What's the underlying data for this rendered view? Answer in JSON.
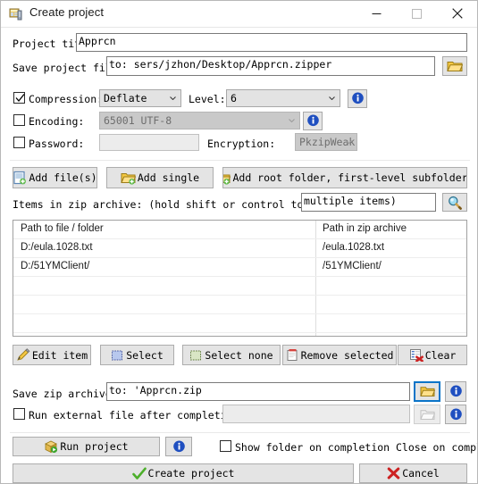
{
  "window": {
    "title": "Create project",
    "icon": "app-window-icon",
    "controls": {
      "minimize": "minimize-icon",
      "maximize": "maximize-icon",
      "close": "close-icon"
    }
  },
  "project": {
    "title_label": "Project title:",
    "title_value": "Apprcn",
    "save_label": "Save project file to:",
    "save_value": "to: sers/jzhon/Desktop/Apprcn.zipper",
    "browse_icon": "folder-icon"
  },
  "options": {
    "compression": {
      "label": "Compression:",
      "checked": true,
      "value": "Deflate"
    },
    "level": {
      "label": "Level:",
      "value": "6"
    },
    "compression_info": "info-icon",
    "encoding": {
      "label": "Encoding:",
      "checked": false,
      "value": "65001 UTF-8"
    },
    "encoding_info": "info-icon",
    "password": {
      "label": "Password:",
      "checked": false,
      "value": ""
    },
    "encryption": {
      "label": "Encryption:",
      "value": "PkzipWeak"
    }
  },
  "add_buttons": [
    {
      "label": "Add file(s)",
      "icon": "add-file-icon"
    },
    {
      "label": "Add single",
      "icon": "add-folder-icon"
    },
    {
      "label": "Add root folder, first-level subfolders",
      "icon": "add-folder-icon"
    }
  ],
  "items_section": {
    "label": "Items in zip archive: (hold shift or control to select",
    "filter_value": "multiple items)",
    "search_icon": "search-icon"
  },
  "table": {
    "columns": [
      "Path to file / folder",
      "Path in zip archive"
    ],
    "rows": [
      [
        "D:/eula.1028.txt",
        "/eula.1028.txt"
      ],
      [
        "D:/51YMClient/",
        "/51YMClient/"
      ]
    ],
    "empty_rows": 4
  },
  "item_buttons": [
    {
      "label": "Edit item",
      "icon": "pencil-icon"
    },
    {
      "label": "Select",
      "icon": "select-all-icon"
    },
    {
      "label": "Select none",
      "icon": "select-none-icon"
    },
    {
      "label": "Remove selected",
      "icon": "remove-icon"
    },
    {
      "label": "Clear",
      "icon": "clear-icon"
    }
  ],
  "output": {
    "zip_label": "Save zip archive to:",
    "zip_value": "to: 'Apprcn.zip",
    "zip_browse_icon": "folder-icon",
    "zip_info_icon": "info-icon",
    "run_external": {
      "label": "Run external file after completion:",
      "checked": false,
      "value": ""
    },
    "run_browse_icon": "folder-icon",
    "run_info_icon": "info-icon"
  },
  "footer": {
    "run_project": {
      "label": "Run project",
      "icon": "run-icon"
    },
    "run_info_icon": "info-icon",
    "show_folder": {
      "label": "Show folder on completion Close on completion",
      "checked": false
    },
    "create_project": {
      "label": "Create project",
      "icon": "check-icon"
    },
    "cancel": {
      "label": "Cancel",
      "icon": "x-icon"
    }
  },
  "colors": {
    "accent": "#0a74c8",
    "info": "#1f4fc0",
    "folder": "#f0c040",
    "ok": "#4caf2a",
    "danger": "#cc2222"
  }
}
